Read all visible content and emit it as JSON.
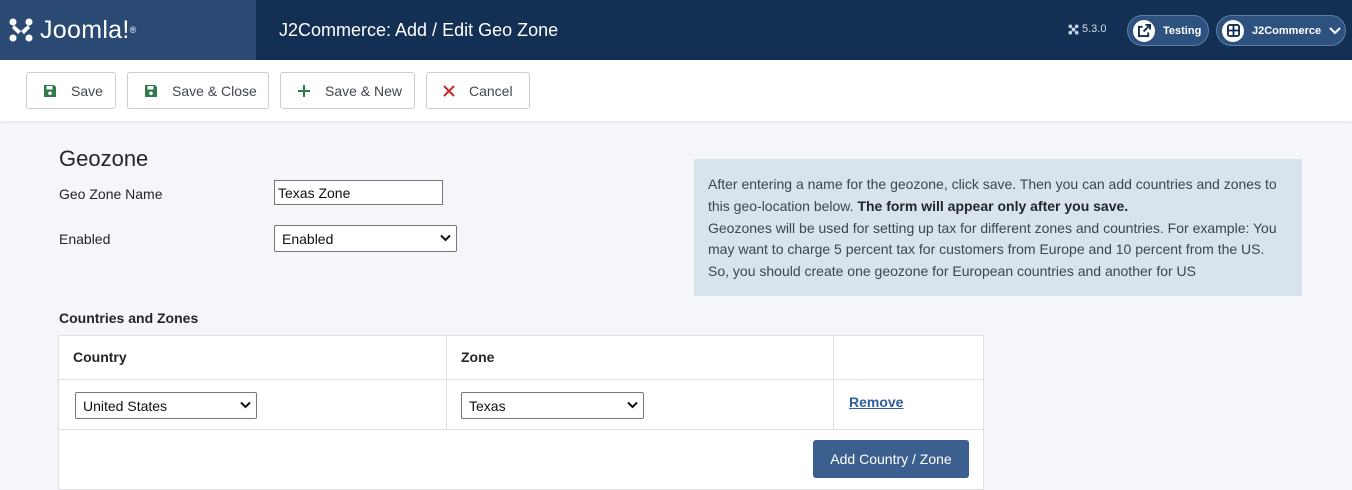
{
  "header": {
    "logo_text": "Joomla!",
    "logo_reg": "®",
    "title": "J2Commerce: Add / Edit Geo Zone",
    "version": "5.3.0",
    "testing_label": "Testing",
    "site_label": "J2Commerce"
  },
  "toolbar": {
    "save_label": "Save",
    "save_close_label": "Save & Close",
    "save_new_label": "Save & New",
    "cancel_label": "Cancel"
  },
  "form": {
    "heading": "Geozone",
    "name_label": "Geo Zone Name",
    "name_value": "Texas Zone",
    "enabled_label": "Enabled",
    "enabled_value": "Enabled"
  },
  "info": {
    "line1": "After entering a name for the geozone, click save. Then you can add countries and zones to this geo-location below. ",
    "line1_bold": "The form will appear only after you save.",
    "line2": "Geozones will be used for setting up tax for different zones and countries. For example: You may want to charge 5 percent tax for customers from Europe and 10 percent from the US. So, you should create one geozone for European countries and another for US"
  },
  "countries_zones": {
    "section_label": "Countries and Zones",
    "col_country": "Country",
    "col_zone": "Zone",
    "rows": [
      {
        "country": "United States",
        "zone": "Texas",
        "remove_label": "Remove"
      }
    ],
    "add_label": "Add Country / Zone"
  },
  "colors": {
    "header_bg": "#132f53",
    "logo_bg": "#2a4a74",
    "primary_button": "#3b5f8e",
    "save_icon": "#2f7a4b",
    "cancel_icon": "#c52827",
    "info_bg": "#d9e3ec"
  }
}
